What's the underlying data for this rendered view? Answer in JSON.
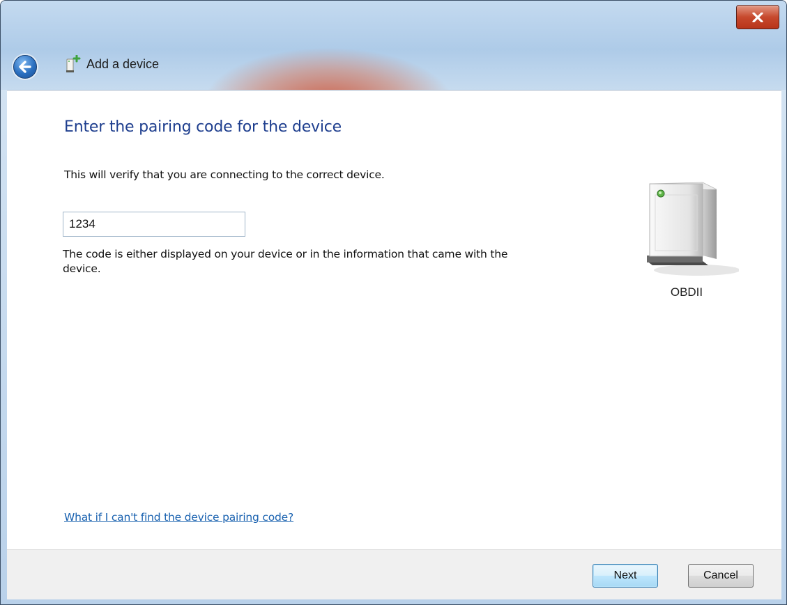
{
  "window": {
    "title": "Add a device",
    "close_symbol": "x"
  },
  "icons": {
    "back": "back-arrow-icon",
    "title": "add-device-icon",
    "device": "bluetooth-device-icon",
    "close": "close-icon"
  },
  "content": {
    "heading": "Enter the pairing code for the device",
    "description": "This will verify that you are connecting to the correct device.",
    "code_input_value": "1234",
    "hint": "The code is either displayed on your device or in the information that came with the device.",
    "help_link": "What if I can't find the device pairing code?"
  },
  "device": {
    "name": "OBDII"
  },
  "footer": {
    "next_label": "Next",
    "cancel_label": "Cancel"
  },
  "colors": {
    "heading": "#1e3e8e",
    "link": "#1a62b0",
    "close_button": "#c7492d"
  }
}
